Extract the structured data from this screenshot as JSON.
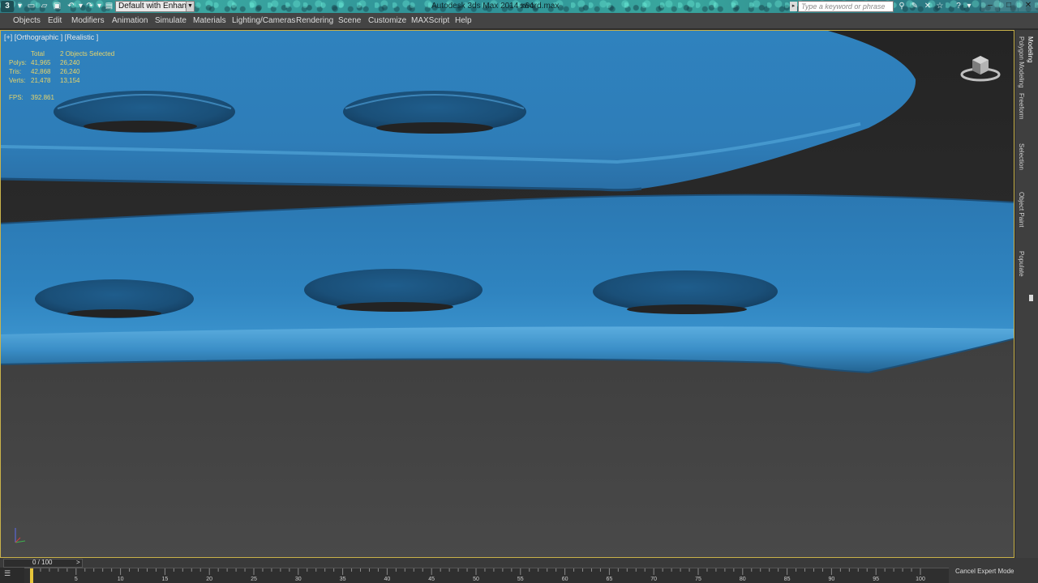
{
  "titlebar": {
    "app_title": "Autodesk 3ds Max  2014 x64",
    "file_name": "sword.max",
    "workspace": "Default with Enhance",
    "search_placeholder": "Type a keyword or phrase"
  },
  "menu": [
    "Objects",
    "Edit",
    "Modifiers",
    "Animation",
    "Simulate",
    "Materials",
    "Lighting/Cameras",
    "Rendering",
    "Scene",
    "Customize",
    "MAXScript",
    "Help"
  ],
  "viewport": {
    "label": "[+] [Orthographic ] [Realistic ]",
    "stats": {
      "header_total": "Total",
      "header_selected": "2 Objects Selected",
      "rows": [
        {
          "label": "Polys:",
          "total": "41,965",
          "selected": "26,240"
        },
        {
          "label": "Tris:",
          "total": "42,868",
          "selected": "26,240"
        },
        {
          "label": "Verts:",
          "total": "21,478",
          "selected": "13,154"
        }
      ],
      "fps_label": "FPS:",
      "fps_value": "392.861"
    }
  },
  "command_tabs": [
    "Modeling",
    "Polygon Modeling",
    "Freeform",
    "Selection",
    "Object Paint",
    "Populate"
  ],
  "time_slider": {
    "label": "0 / 100",
    "next": ">"
  },
  "trackbar": {
    "frames": [
      "5",
      "10",
      "15",
      "20",
      "25",
      "30",
      "35",
      "40",
      "45",
      "50",
      "55",
      "60",
      "65",
      "70",
      "75",
      "80",
      "85",
      "90",
      "95",
      "100"
    ]
  },
  "status": {
    "cancel_expert": "Cancel Expert Mode"
  },
  "colors": {
    "mesh": "#2f7fb9",
    "viewport_border": "#c9b24a",
    "stats_text": "#e6d46a"
  },
  "icons": [
    "app-logo-icon",
    "new-file-icon",
    "open-file-icon",
    "save-icon",
    "undo-icon",
    "redo-icon",
    "project-folder-icon",
    "binoculars-icon",
    "tools-icon",
    "star-icon",
    "help-icon",
    "minimize-icon",
    "maximize-icon",
    "close-icon",
    "viewcube-icon",
    "axis-tripod-icon",
    "mini-listener-icon"
  ]
}
